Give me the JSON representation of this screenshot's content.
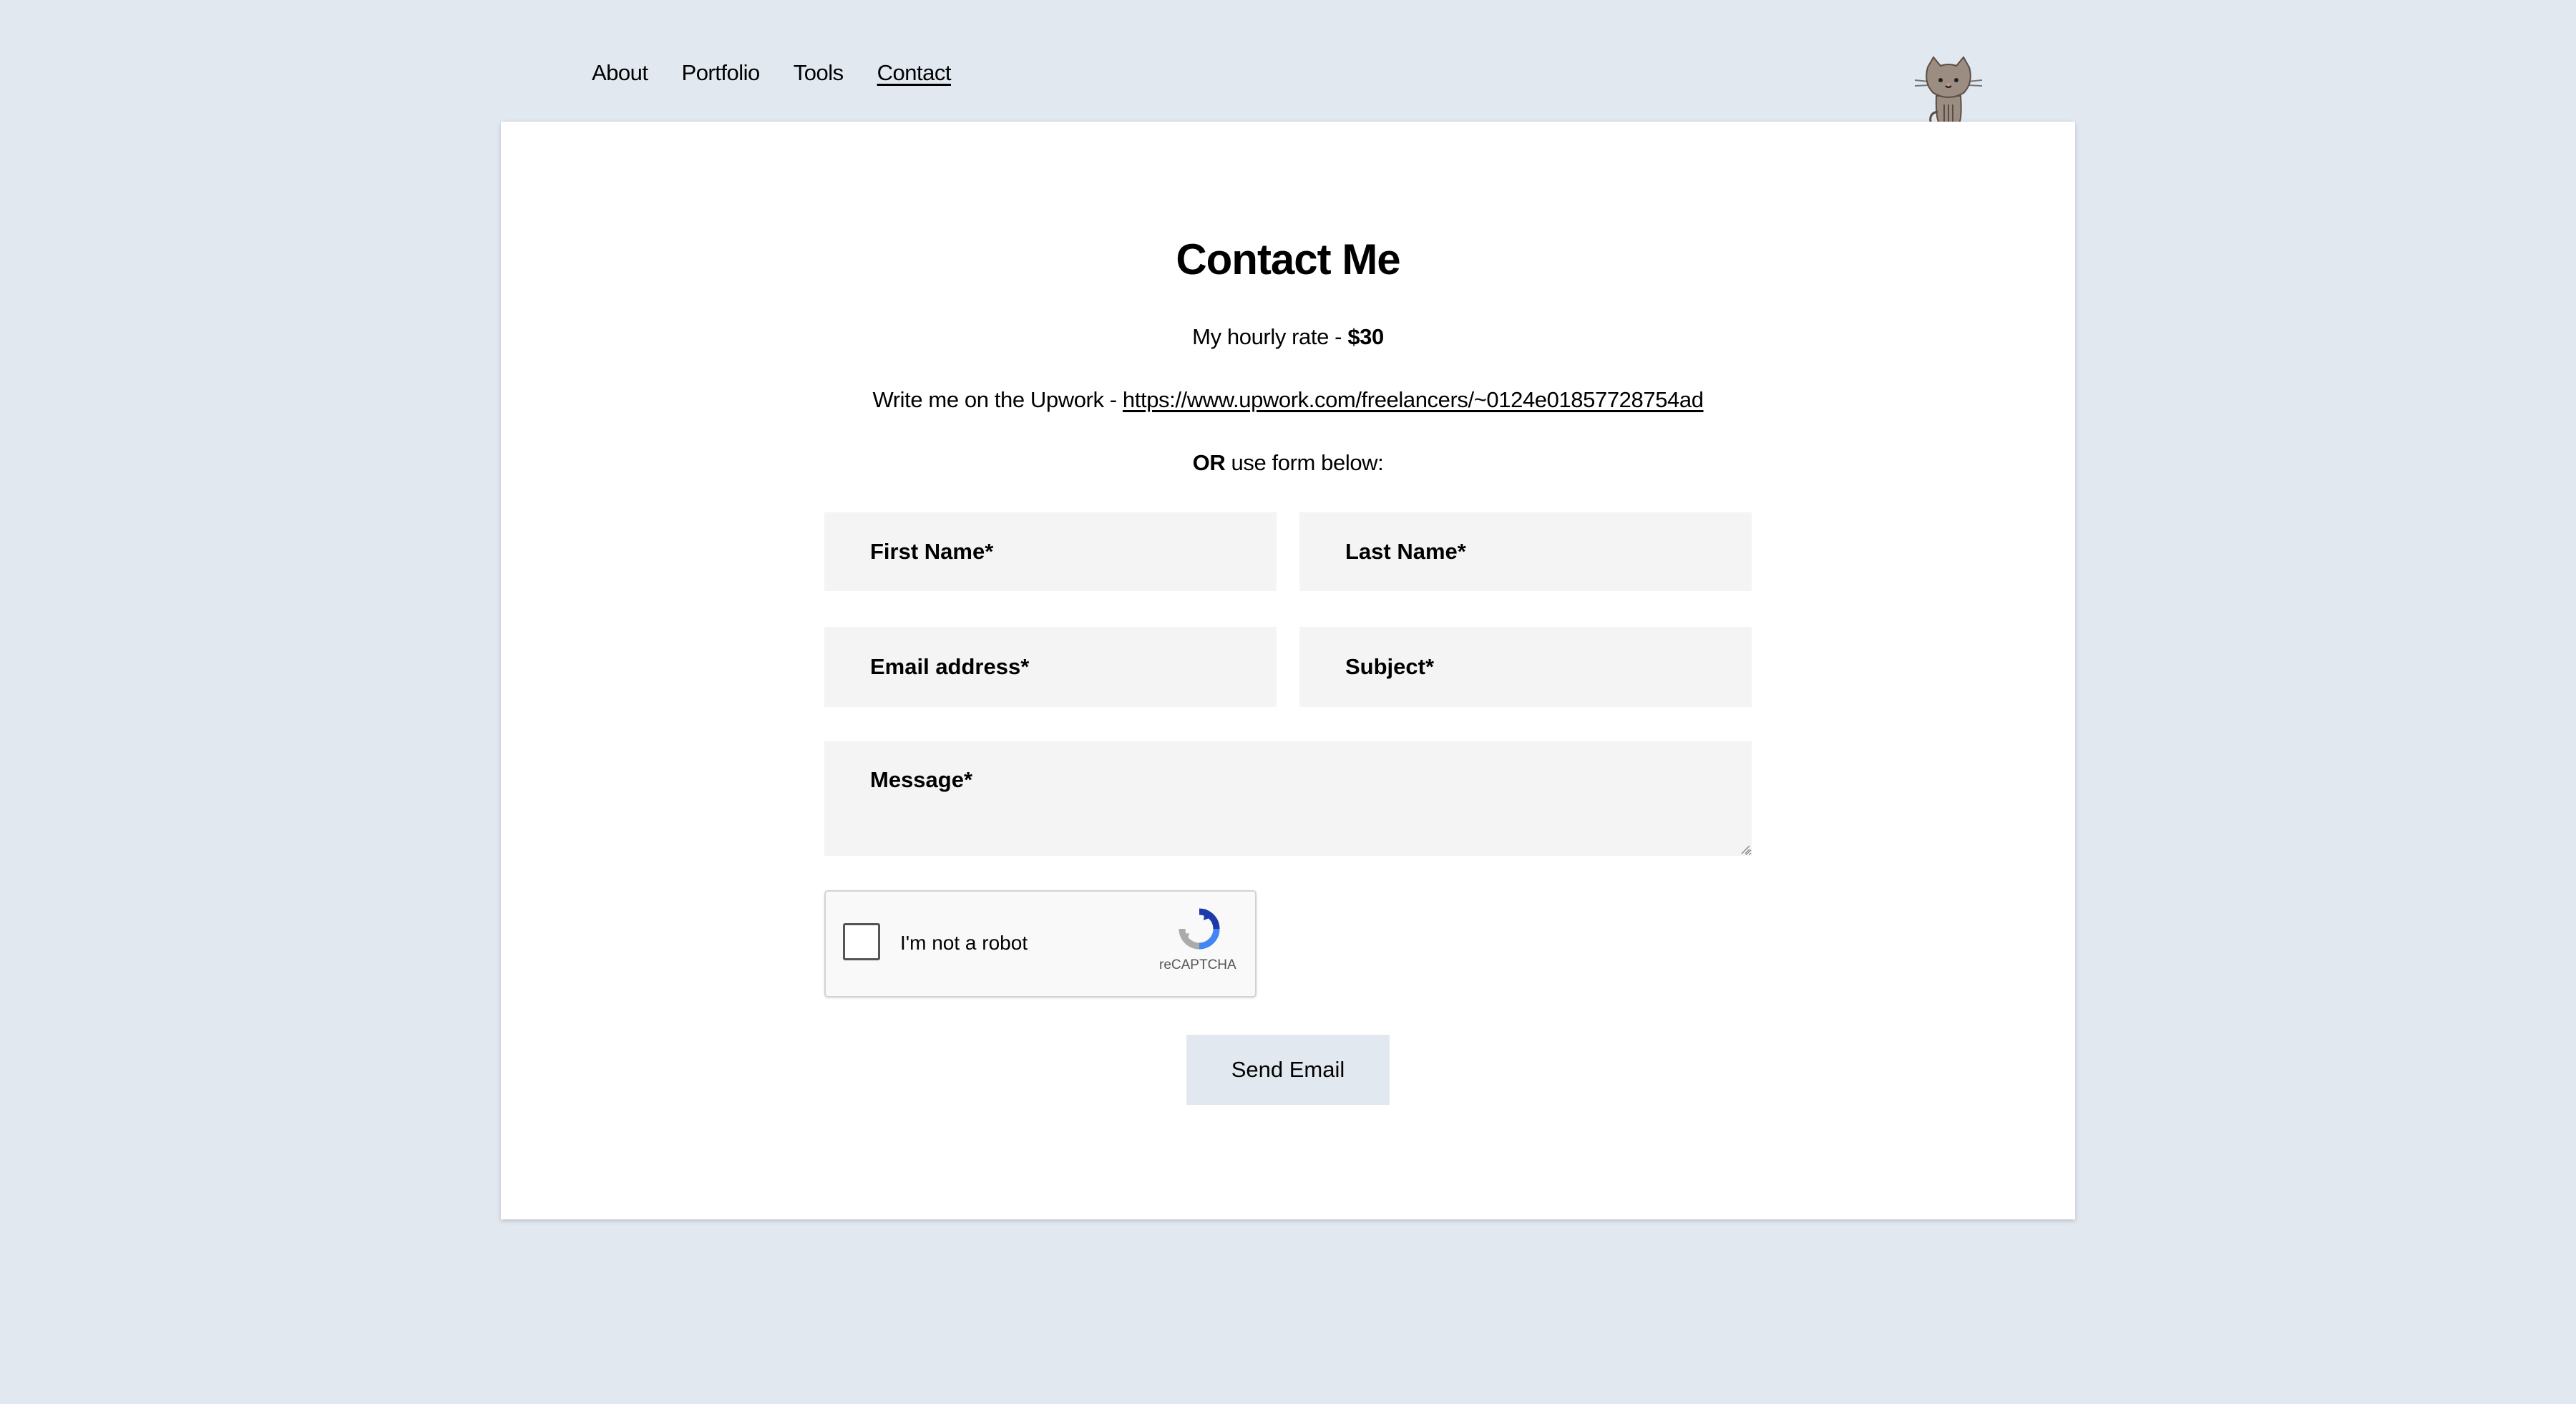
{
  "nav": {
    "items": [
      {
        "label": "About"
      },
      {
        "label": "Portfolio"
      },
      {
        "label": "Tools"
      },
      {
        "label": "Contact",
        "active": true
      }
    ]
  },
  "page": {
    "title": "Contact Me",
    "rate_prefix": "My hourly rate - ",
    "rate_value": "$30",
    "upwork_prefix": "Write me on the Upwork - ",
    "upwork_link": "https://www.upwork.com/freelancers/~0124e01857728754ad",
    "or_bold": "OR",
    "or_rest": " use form below:"
  },
  "form": {
    "first_name_placeholder": "First Name*",
    "last_name_placeholder": "Last Name*",
    "email_placeholder": "Email address*",
    "subject_placeholder": "Subject*",
    "message_placeholder": "Message*",
    "send_label": "Send Email"
  },
  "captcha": {
    "label": "I'm not a robot",
    "brand": "reCAPTCHA"
  },
  "colors": {
    "background": "#e1e8f0",
    "card": "#ffffff",
    "field": "#f4f4f4",
    "button": "#e1e8f0"
  },
  "icons": {
    "mascot": "cat-icon",
    "captcha": "recaptcha-icon"
  }
}
